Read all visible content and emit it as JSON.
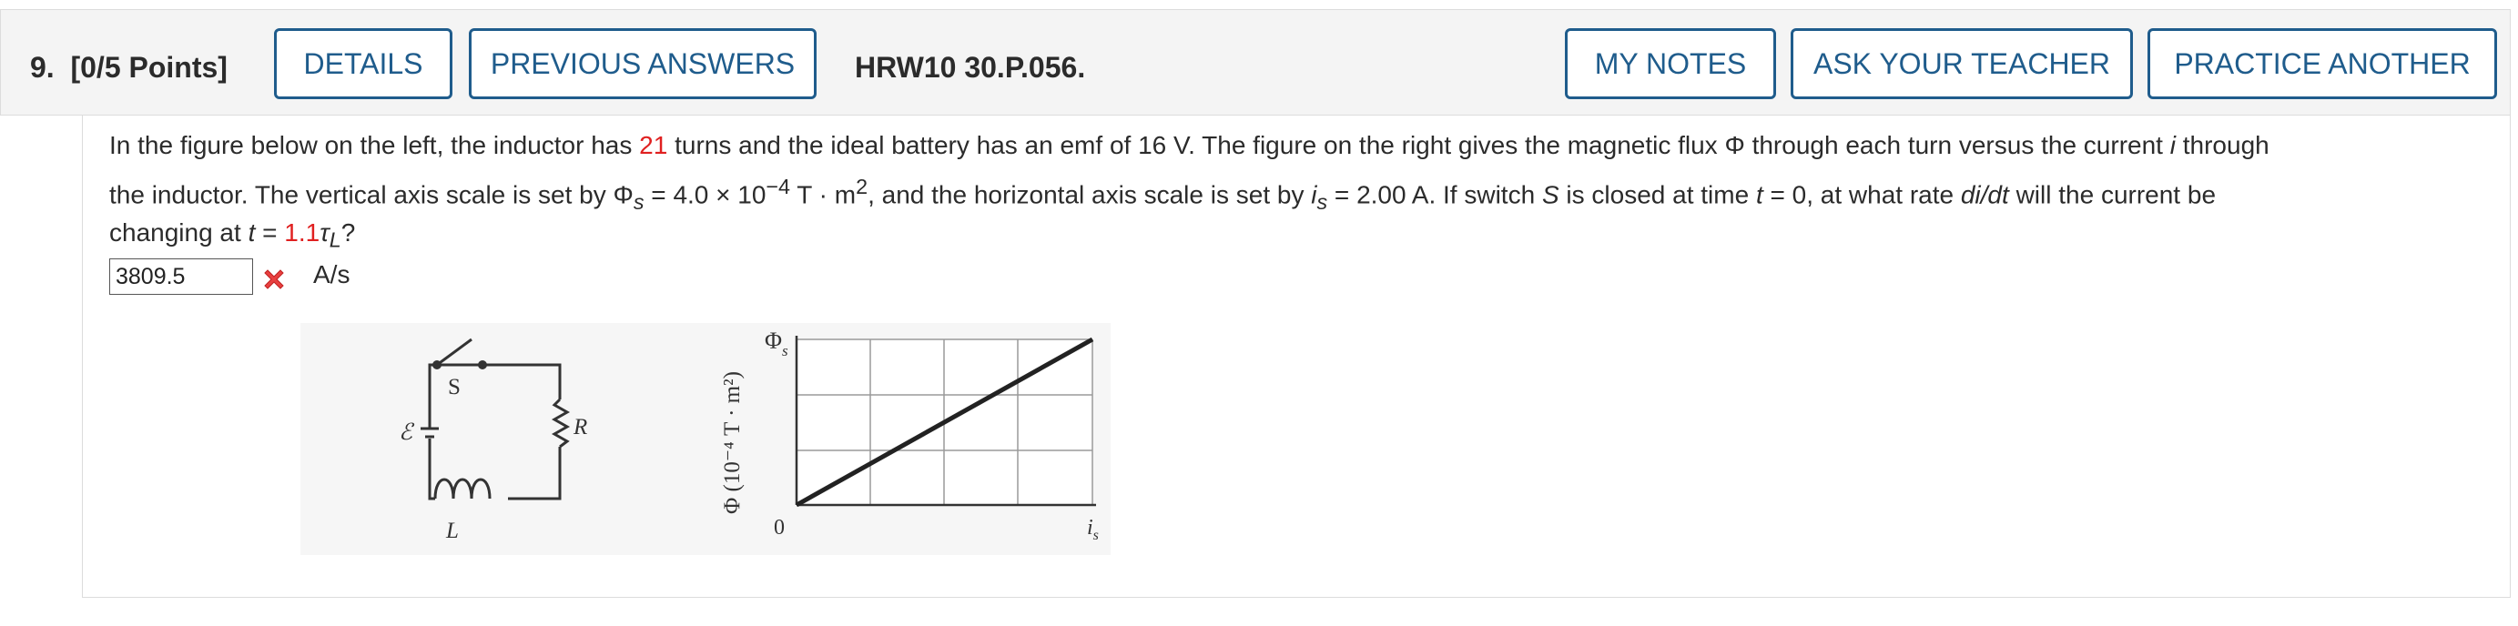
{
  "header": {
    "question_label": "9.",
    "points": "[0/5 Points]",
    "details": "DETAILS",
    "previous_answers": "PREVIOUS ANSWERS",
    "code": "HRW10 30.P.056.",
    "my_notes": "MY NOTES",
    "ask_teacher": "ASK YOUR TEACHER",
    "practice_another": "PRACTICE ANOTHER"
  },
  "problem": {
    "l1a": "In the figure below on the left, the inductor has ",
    "l1_turns": "21",
    "l1b": " turns and the ideal battery has an emf of 16 V. The figure on the right gives the magnetic flux Φ through each turn versus the current ",
    "l1_i": "i",
    "l1c": " through",
    "l2a": "the inductor. The vertical axis scale is set by Φ",
    "l2_sub_s": "s",
    "l2b": " = 4.0 × 10",
    "l2_exp": "−4",
    "l2c": " T · m",
    "l2_sq": "2",
    "l2d": ", and the horizontal axis scale is set by ",
    "l2_is": "i",
    "l2_is_sub": "s",
    "l2e": " = 2.00 A. If switch ",
    "l2_S": "S",
    "l2f": " is closed at time ",
    "l2_t": "t",
    "l2g": " = 0, at what rate ",
    "l2_didt": "di/dt",
    "l2h": " will the current be",
    "l3a": "changing at ",
    "l3_t": "t",
    "l3b": " = ",
    "l3_val": "1.1",
    "l3_tau": "τ",
    "l3_tau_sub": "L",
    "l3c": "?"
  },
  "answer": {
    "value": "3809.5",
    "unit": "A/s",
    "status": "incorrect"
  },
  "figure": {
    "circuit": {
      "switch": "S",
      "emf": "ℰ",
      "resistor": "R",
      "inductor": "L"
    },
    "graph": {
      "y_label": "Φ (10⁻⁴ T · m²)",
      "y_tick": "Φ",
      "y_tick_sub": "s",
      "x_origin": "0",
      "x_tick": "i",
      "x_tick_sub": "s"
    }
  },
  "colors": {
    "accent": "#1f5c8c",
    "highlight": "#e02020",
    "header_bg": "#f4f4f4"
  }
}
